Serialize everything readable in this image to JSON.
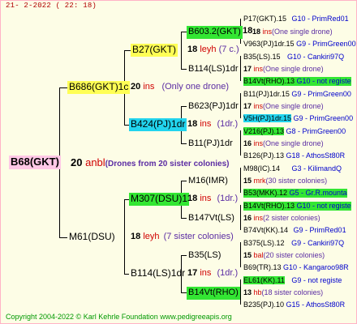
{
  "header": "21-  2-2022 ( 22: 18)",
  "footer": "Copyright 2004-2022 © Karl Kehrle Foundation    www.pedigreeapis.org",
  "root": {
    "name": "B68(GKT)",
    "num": "20",
    "unit": "anbl",
    "note": "(Drones from 20 sister colonies)"
  },
  "sire": {
    "name": "B686(GKT)1c",
    "num": "20",
    "unit": "ins",
    "note": "(Only one drone)"
  },
  "dam": {
    "name": "M61(DSU)",
    "num": "18",
    "unit": "leyh",
    "note": "(7 sister colonies)"
  },
  "g3": [
    {
      "name": "B27(GKT)",
      "num": "18",
      "unit": "leyh",
      "note": "(7 c.)"
    },
    {
      "name": "B424(PJ)1dr",
      "num": "18",
      "unit": "ins",
      "note": "(1dr.)"
    },
    {
      "name": "M307(DSU)1",
      "num": "18",
      "unit": "ins",
      "note": "(1dr.)"
    },
    {
      "name": "B114(LS)1dr",
      "num": "17",
      "unit": "ins",
      "note": "(1dr.)"
    }
  ],
  "g4": [
    {
      "name": "B603.2(GKT)",
      "num": "18"
    },
    {
      "name": "B114(LS)1dr"
    },
    {
      "name": "B623(PJ)1dr"
    },
    {
      "name": "B11(PJ)1dr"
    },
    {
      "name": "M16(IMR)"
    },
    {
      "name": "B147Vt(LS)"
    },
    {
      "name": "B35(LS)"
    },
    {
      "name": "B14Vt(RHO)"
    }
  ],
  "g5": [
    {
      "id": "P17(GKT).15",
      "ref": "G10 - PrimRed01"
    },
    {
      "id": "18",
      "unit": "ins",
      "note": "(One single drone)"
    },
    {
      "id": "V963(PJ)1dr.15",
      "ref": "G9 - PrimGreen00"
    },
    {
      "id": "B35(LS).15",
      "ref": "G10 - Cankiri97Q"
    },
    {
      "id": "17",
      "unit": "ins",
      "note": "(One single drone)"
    },
    {
      "id": "B14Vt(RHO).13",
      "ref": "G10 - not registe"
    },
    {
      "id": "B11(PJ)1dr.15",
      "ref": "G9 - PrimGreen00"
    },
    {
      "id": "17",
      "unit": "ins",
      "note": "(One single drone)"
    },
    {
      "id": "V5H(PJ)1dr.15",
      "ref": "G9 - PrimGreen00"
    },
    {
      "id": "V216(PJ).13",
      "ref": "G8 - PrimGreen00"
    },
    {
      "id": "16",
      "unit": "ins",
      "note": "(One single drone)"
    },
    {
      "id": "B126(PJ).13",
      "ref": "G18 - AthosSt80R"
    },
    {
      "id": "M98(IC).14",
      "ref": "G3 - KilimandQ"
    },
    {
      "id": "15",
      "unit": "mrk",
      "note": "(30 sister colonies)"
    },
    {
      "id": "B53(MKK).12",
      "ref": "G5 - Gr.R.mounta"
    },
    {
      "id": "B14Vt(RHO).13",
      "ref": "G10 - not registe"
    },
    {
      "id": "16",
      "unit": "ins",
      "note": "(2 sister colonies)"
    },
    {
      "id": "B74Vt(KK).14",
      "ref": "G9 - PrimRed01"
    },
    {
      "id": "B375(LS).12",
      "ref": "G9 - Cankiri97Q"
    },
    {
      "id": "15",
      "unit": "bal",
      "note": "(20 sister colonies)"
    },
    {
      "id": "B69(TR).13",
      "ref": "G10 - Kangaroo98R"
    },
    {
      "id": "EL61(KK).11",
      "ref": "G9 - not registe"
    },
    {
      "id": "13",
      "unit": "hb",
      "note": "(18 sister colonies)"
    },
    {
      "id": "B235(PJ).10",
      "ref": "G15 - AthosSt80R"
    }
  ],
  "colors": {
    "pink": "#ffc8e6",
    "yellow": "#ffff55",
    "cyan": "#22d4ee",
    "green": "#33e633"
  }
}
